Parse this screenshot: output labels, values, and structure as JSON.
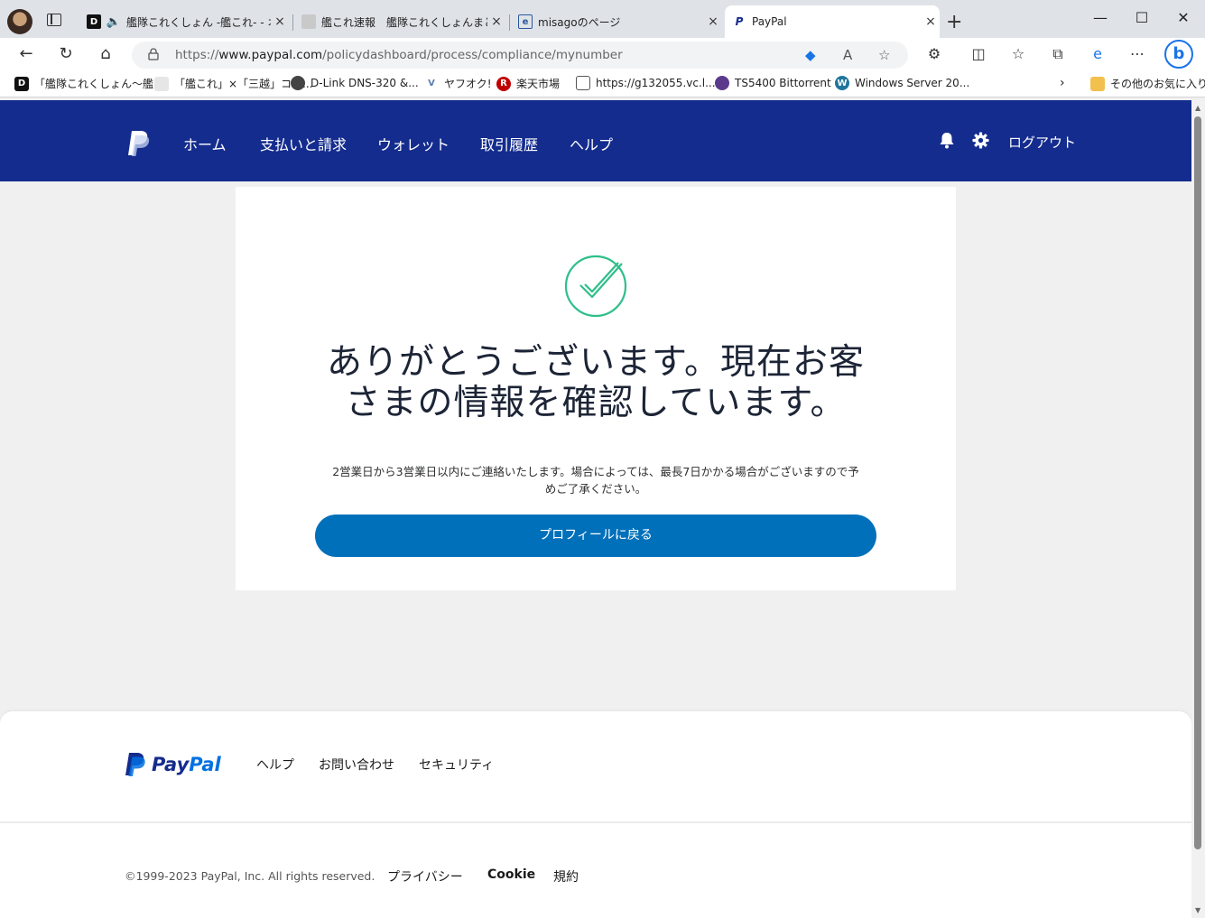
{
  "browser": {
    "tabs": [
      {
        "title": "艦隊これくしょん -艦これ- - オン",
        "close": "×"
      },
      {
        "title": "艦これ速報　艦隊これくしょんまとめ",
        "close": "×"
      },
      {
        "title": "misagoのページ",
        "close": "×"
      },
      {
        "title": "PayPal",
        "close": "×"
      }
    ],
    "new_tab": "+",
    "url_prefix": "https://",
    "url_host": "www.paypal.com",
    "url_path": "/policydashboard/process/compliance/mynumber",
    "bookmarks": [
      "「艦隊これくしょん～艦...",
      "「艦これ」×「三越」コラ...",
      "D-Link DNS-320 &...",
      "ヤフオク!",
      "楽天市場",
      "https://g132055.vc.l...",
      "TS5400 Bittorrent",
      "Windows Server 20..."
    ],
    "other_favorites": "その他のお気に入り"
  },
  "header": {
    "nav": [
      "ホーム",
      "支払いと請求",
      "ウォレット",
      "取引履歴",
      "ヘルプ"
    ],
    "logout": "ログアウト"
  },
  "main": {
    "headline_line1": "ありがとうございます。現在お客",
    "headline_line2": "さまの情報を確認しています。",
    "subtext_line1": "2営業日から3営業日以内にご連絡いたします。場合によっては、最長7日かかる場合がございますので予",
    "subtext_line2": "めご了承ください。",
    "button": "プロフィールに戻る"
  },
  "footer": {
    "brand_pay": "Pay",
    "brand_pal": "Pal",
    "links": [
      "ヘルプ",
      "お問い合わせ",
      "セキュリティ"
    ],
    "copyright": "©1999-2023 PayPal, Inc. All rights reserved.",
    "legal": [
      "プライバシー",
      "Cookie",
      "規約"
    ]
  },
  "colors": {
    "header_bg": "#142c8e",
    "button_bg": "#0070ba",
    "check_green": "#2fbf8a"
  }
}
